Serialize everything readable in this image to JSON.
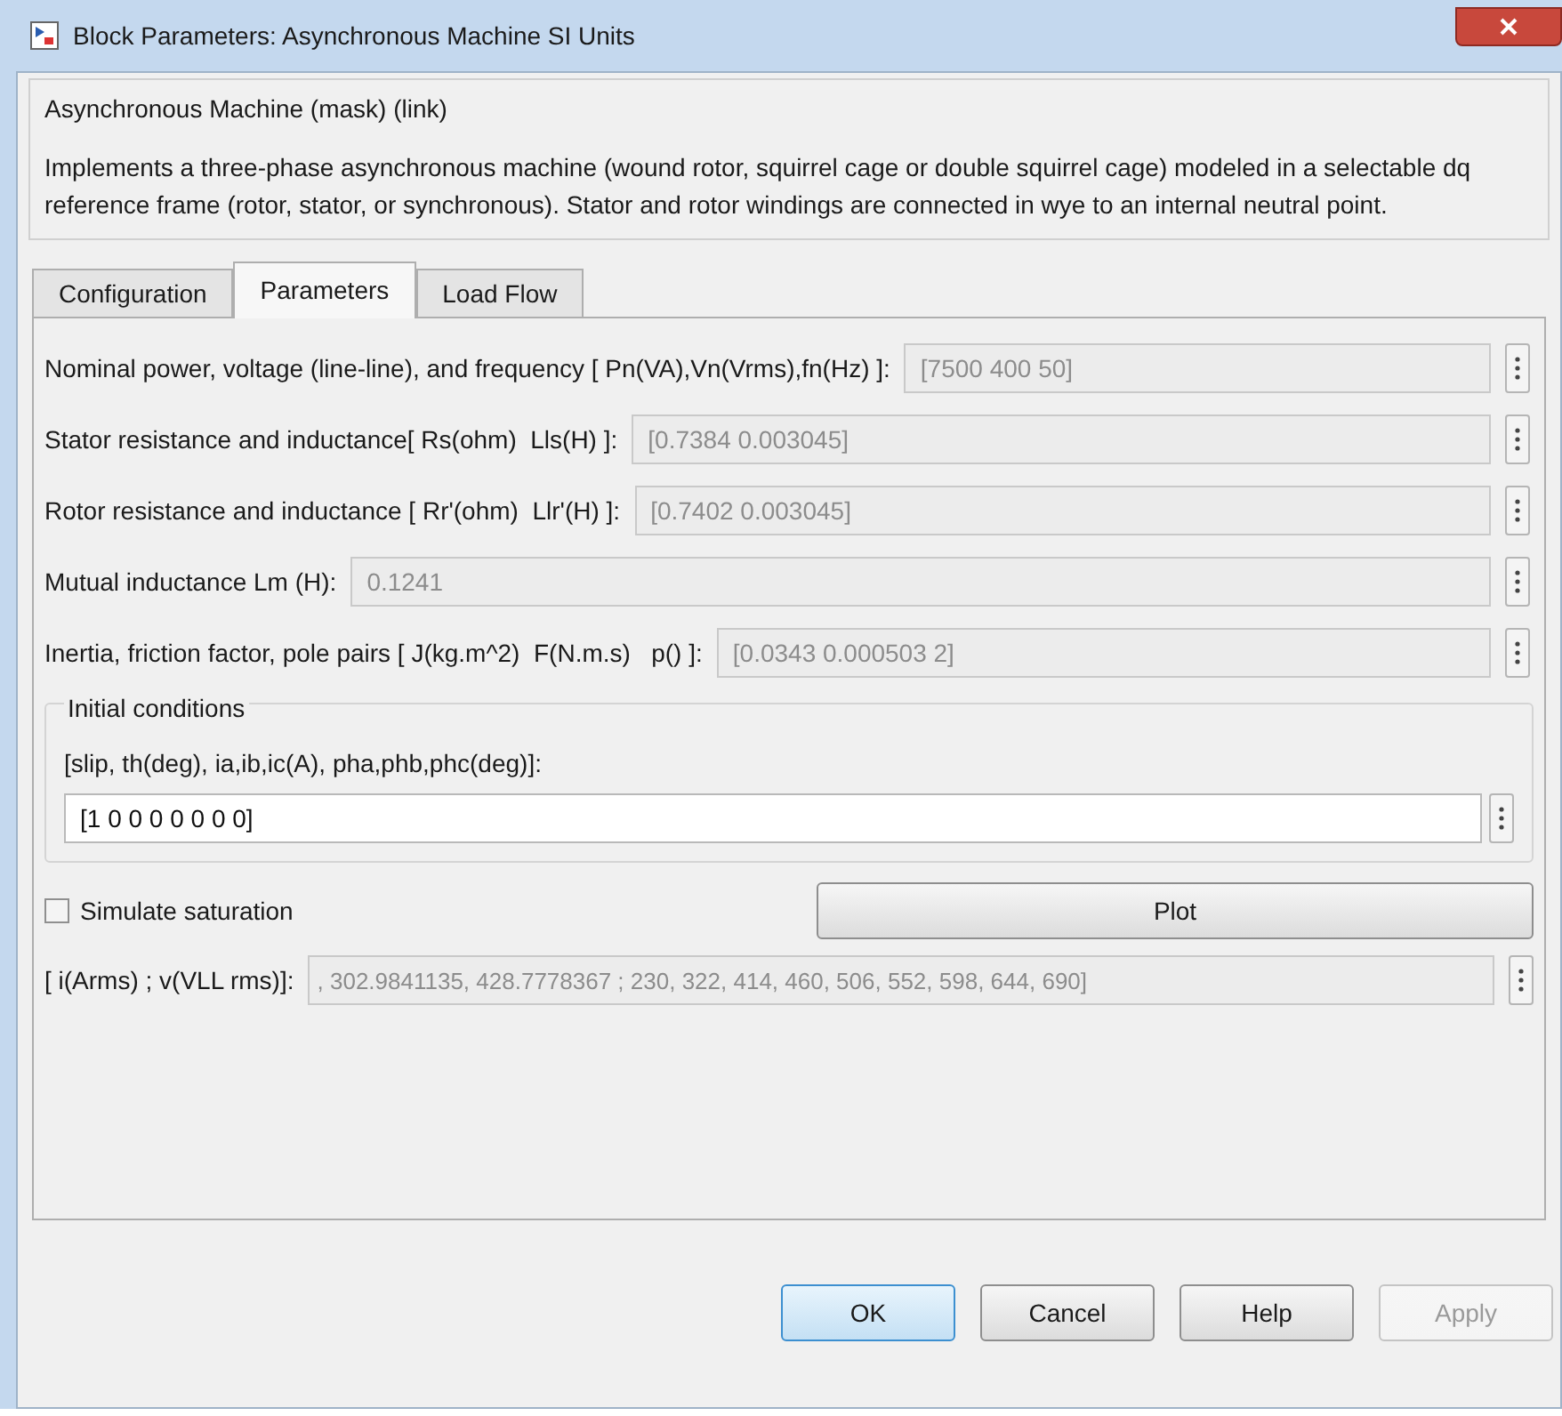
{
  "window": {
    "title": "Block Parameters: Asynchronous Machine SI Units"
  },
  "mask": {
    "title": "Asynchronous Machine (mask) (link)",
    "description": "Implements a three-phase asynchronous machine (wound rotor, squirrel cage or double squirrel cage) modeled in a selectable dq reference frame (rotor, stator, or synchronous). Stator and rotor windings are connected in wye to an internal neutral point."
  },
  "tabs": [
    {
      "label": "Configuration",
      "selected": false
    },
    {
      "label": "Parameters",
      "selected": true
    },
    {
      "label": "Load Flow",
      "selected": false
    }
  ],
  "parameters": [
    {
      "label": "Nominal power, voltage (line-line), and frequency [ Pn(VA),Vn(Vrms),fn(Hz) ]:",
      "value": "[7500 400 50]",
      "disabled": true
    },
    {
      "label": "Stator resistance and inductance[ Rs(ohm)  Lls(H) ]:",
      "value": "[0.7384 0.003045]",
      "disabled": true
    },
    {
      "label": "Rotor resistance and inductance [ Rr'(ohm)  Llr'(H) ]:",
      "value": "[0.7402 0.003045]",
      "disabled": true
    },
    {
      "label": "Mutual inductance Lm (H):",
      "value": "0.1241",
      "disabled": true
    },
    {
      "label": "Inertia, friction factor, pole pairs [ J(kg.m^2)  F(N.m.s)   p() ]:",
      "value": "[0.0343 0.000503 2]",
      "disabled": true
    }
  ],
  "initial_conditions": {
    "title": "Initial conditions",
    "label": "[slip, th(deg), ia,ib,ic(A), pha,phb,phc(deg)]:",
    "value": "[1 0 0 0 0 0 0 0]",
    "disabled": false
  },
  "saturation": {
    "label": "Simulate saturation",
    "checked": false
  },
  "plot_button": {
    "label": "Plot"
  },
  "saturation_data": {
    "label": "[ i(Arms) ; v(VLL rms)]:",
    "value": ", 302.9841135, 428.7778367 ; 230, 322, 414, 460, 506, 552, 598, 644, 690]",
    "disabled": true
  },
  "buttons": [
    {
      "label": "OK",
      "default": true,
      "disabled": false
    },
    {
      "label": "Cancel",
      "default": false,
      "disabled": false
    },
    {
      "label": "Help",
      "default": false,
      "disabled": false
    },
    {
      "label": "Apply",
      "default": false,
      "disabled": true
    }
  ]
}
